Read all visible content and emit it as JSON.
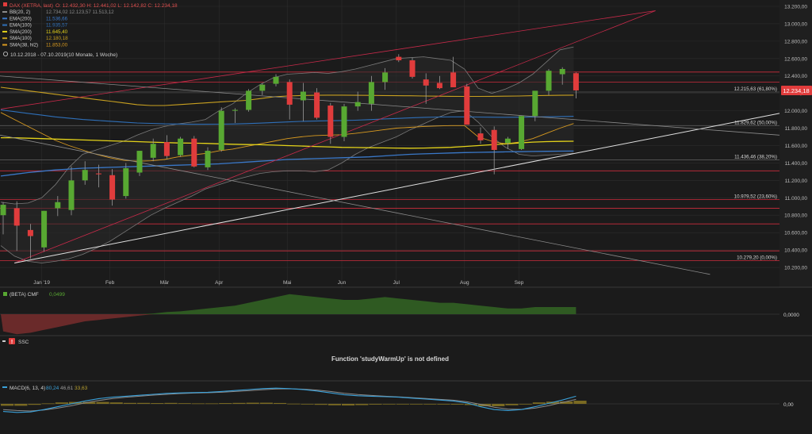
{
  "instrument": {
    "symbol": "DAX (XETRA, last)",
    "ohlc": "O: 12.432,30  H: 12.441,02  L: 12.142,82  C: 12.234,18",
    "current_price_label": "12.234,18",
    "period": "10.12.2018 - 07.10.2019",
    "period_note": "(10 Monate, 1 Woche)"
  },
  "legend": [
    {
      "label": "BB(20, 2)",
      "values": "12.734,02  12.123,57  11.513,12",
      "color": "#8a8a8a"
    },
    {
      "label": "EMA(200)",
      "values": "11.536,66",
      "color": "#3a78c8"
    },
    {
      "label": "EMA(100)",
      "values": "11.935,57",
      "color": "#2f6fb8"
    },
    {
      "label": "SMA(200)",
      "values": "11.645,40",
      "color": "#e3d21a"
    },
    {
      "label": "SMA(100)",
      "values": "12.180,18",
      "color": "#c8a020"
    },
    {
      "label": "SMA(38, hl2)",
      "values": "11.853,00",
      "color": "#d89a20"
    }
  ],
  "indicators": {
    "cmf": {
      "label": "(BETA) CMF",
      "value": "0,0499",
      "zero_label": "0,0000"
    },
    "ssc": {
      "label": "SSC",
      "error": "Function 'studyWarmUp' is not defined"
    },
    "macd": {
      "label": "MACD(6, 13, 4)",
      "v1": "80,24",
      "v2": "46,61",
      "v3": "33,63",
      "zero_label": "0,00"
    }
  },
  "colors": {
    "up": "#58a832",
    "down": "#e03c3c",
    "fib": "#cc2c3c",
    "grid": "#2c2c2c",
    "background": "#1b1b1b"
  },
  "chart_data": {
    "type": "candlestick",
    "ylim": [
      10100,
      13200
    ],
    "y_ticks": [
      "13.200,00",
      "13.000,00",
      "12.800,00",
      "12.600,00",
      "12.400,00",
      "12.200,00",
      "12.000,00",
      "11.800,00",
      "11.600,00",
      "11.400,00",
      "11.200,00",
      "11.000,00",
      "10.800,00",
      "10.600,00",
      "10.400,00",
      "10.200,00"
    ],
    "x_labels": [
      {
        "label": "Jan '19",
        "week": 3
      },
      {
        "label": "Feb",
        "week": 8
      },
      {
        "label": "Mär",
        "week": 12
      },
      {
        "label": "Apr",
        "week": 16
      },
      {
        "label": "Mai",
        "week": 21
      },
      {
        "label": "Jun",
        "week": 25
      },
      {
        "label": "Jul",
        "week": 29
      },
      {
        "label": "Aug",
        "week": 34
      },
      {
        "label": "Sep",
        "week": 38
      }
    ],
    "candles": [
      {
        "o": 10800,
        "h": 10950,
        "l": 10580,
        "c": 10920
      },
      {
        "o": 10880,
        "h": 10960,
        "l": 10390,
        "c": 10680
      },
      {
        "o": 10630,
        "h": 10700,
        "l": 10300,
        "c": 10560
      },
      {
        "o": 10430,
        "h": 10850,
        "l": 10380,
        "c": 10850
      },
      {
        "o": 10880,
        "h": 11020,
        "l": 10790,
        "c": 10950
      },
      {
        "o": 10860,
        "h": 11360,
        "l": 10800,
        "c": 11200
      },
      {
        "o": 11200,
        "h": 11420,
        "l": 11150,
        "c": 11320
      },
      {
        "o": 11280,
        "h": 11380,
        "l": 11120,
        "c": 11270
      },
      {
        "o": 11260,
        "h": 11330,
        "l": 10910,
        "c": 10980
      },
      {
        "o": 11020,
        "h": 11400,
        "l": 10990,
        "c": 11340
      },
      {
        "o": 11290,
        "h": 11540,
        "l": 11250,
        "c": 11540
      },
      {
        "o": 11460,
        "h": 11680,
        "l": 11420,
        "c": 11620
      },
      {
        "o": 11640,
        "h": 11720,
        "l": 11450,
        "c": 11480
      },
      {
        "o": 11490,
        "h": 11700,
        "l": 11470,
        "c": 11680
      },
      {
        "o": 11680,
        "h": 11710,
        "l": 11350,
        "c": 11360
      },
      {
        "o": 11350,
        "h": 11580,
        "l": 11320,
        "c": 11540
      },
      {
        "o": 11550,
        "h": 12040,
        "l": 11530,
        "c": 12000
      },
      {
        "o": 12000,
        "h": 12030,
        "l": 11860,
        "c": 12010
      },
      {
        "o": 12010,
        "h": 12250,
        "l": 11990,
        "c": 12230
      },
      {
        "o": 12230,
        "h": 12320,
        "l": 12180,
        "c": 12300
      },
      {
        "o": 12310,
        "h": 12420,
        "l": 12280,
        "c": 12390
      },
      {
        "o": 12330,
        "h": 12360,
        "l": 11900,
        "c": 12070
      },
      {
        "o": 12120,
        "h": 12320,
        "l": 11880,
        "c": 12220
      },
      {
        "o": 12210,
        "h": 12260,
        "l": 11900,
        "c": 11920
      },
      {
        "o": 12060,
        "h": 12090,
        "l": 11620,
        "c": 11700
      },
      {
        "o": 11700,
        "h": 12080,
        "l": 11650,
        "c": 12050
      },
      {
        "o": 12050,
        "h": 12220,
        "l": 12000,
        "c": 12100
      },
      {
        "o": 12080,
        "h": 12400,
        "l": 12000,
        "c": 12330
      },
      {
        "o": 12330,
        "h": 12490,
        "l": 12240,
        "c": 12440
      },
      {
        "o": 12620,
        "h": 12650,
        "l": 12560,
        "c": 12580
      },
      {
        "o": 12580,
        "h": 12610,
        "l": 12370,
        "c": 12390
      },
      {
        "o": 12360,
        "h": 12430,
        "l": 12080,
        "c": 12290
      },
      {
        "o": 12320,
        "h": 12400,
        "l": 12250,
        "c": 12260
      },
      {
        "o": 12440,
        "h": 12620,
        "l": 12270,
        "c": 12270
      },
      {
        "o": 12280,
        "h": 12310,
        "l": 11860,
        "c": 11840
      },
      {
        "o": 11740,
        "h": 11810,
        "l": 11620,
        "c": 11660
      },
      {
        "o": 11780,
        "h": 11820,
        "l": 11270,
        "c": 11550
      },
      {
        "o": 11630,
        "h": 11700,
        "l": 11560,
        "c": 11680
      },
      {
        "o": 11560,
        "h": 11940,
        "l": 11550,
        "c": 11940
      },
      {
        "o": 11940,
        "h": 12210,
        "l": 11880,
        "c": 12230
      },
      {
        "o": 12230,
        "h": 12480,
        "l": 12180,
        "c": 12460
      },
      {
        "o": 12420,
        "h": 12500,
        "l": 12300,
        "c": 12480
      },
      {
        "o": 12432,
        "h": 12441,
        "l": 12142,
        "c": 12234
      }
    ],
    "fib_levels": [
      {
        "value": 12445,
        "label": ""
      },
      {
        "value": 12328,
        "label": ""
      },
      {
        "value": 12215.63,
        "label": "12.215,63 (61,80%)"
      },
      {
        "value": 11829.62,
        "label": "11.829,62 (50,00%)"
      },
      {
        "value": 11436.46,
        "label": "11.436,46 (38,20%)"
      },
      {
        "value": 11310,
        "label": ""
      },
      {
        "value": 10979.52,
        "label": "10.979,52 (23,60%)"
      },
      {
        "value": 10880,
        "label": ""
      },
      {
        "value": 10700,
        "label": ""
      },
      {
        "value": 10390,
        "label": ""
      },
      {
        "value": 10279.2,
        "label": "10.279,20 (0,00%)"
      }
    ],
    "series": {
      "sma200": [
        11690,
        11690,
        11685,
        11680,
        11675,
        11670,
        11665,
        11660,
        11655,
        11650,
        11645,
        11640,
        11635,
        11630,
        11628,
        11625,
        11620,
        11615,
        11612,
        11610,
        11605,
        11600,
        11595,
        11590,
        11585,
        11580,
        11578,
        11575,
        11573,
        11572,
        11570,
        11572,
        11575,
        11580,
        11590,
        11600,
        11610,
        11620,
        11630,
        11640,
        11645,
        11648,
        11650
      ],
      "ema200": [
        11250,
        11270,
        11290,
        11305,
        11320,
        11330,
        11340,
        11345,
        11350,
        11355,
        11360,
        11365,
        11370,
        11375,
        11380,
        11385,
        11390,
        11400,
        11410,
        11420,
        11430,
        11440,
        11445,
        11450,
        11455,
        11460,
        11465,
        11470,
        11480,
        11490,
        11500,
        11505,
        11510,
        11515,
        11520,
        11522,
        11525,
        11528,
        11530,
        11532,
        11534,
        11536,
        11537
      ],
      "ema100": [
        12010,
        11990,
        11970,
        11950,
        11930,
        11915,
        11900,
        11890,
        11880,
        11870,
        11860,
        11855,
        11850,
        11848,
        11845,
        11845,
        11846,
        11848,
        11852,
        11858,
        11865,
        11872,
        11878,
        11882,
        11885,
        11888,
        11892,
        11898,
        11905,
        11912,
        11918,
        11924,
        11928,
        11930,
        11930,
        11928,
        11926,
        11925,
        11926,
        11928,
        11931,
        11934,
        11936
      ],
      "sma100": [
        12270,
        12250,
        12230,
        12210,
        12190,
        12170,
        12150,
        12130,
        12110,
        12090,
        12070,
        12060,
        12060,
        12070,
        12080,
        12090,
        12100,
        12110,
        12120,
        12140,
        12160,
        12170,
        12175,
        12178,
        12180,
        12180,
        12178,
        12177,
        12175,
        12173,
        12172,
        12170,
        12168,
        12166,
        12165,
        12165,
        12166,
        12168,
        12170,
        12173,
        12176,
        12178,
        12180
      ],
      "sma38": [
        11980,
        11900,
        11820,
        11740,
        11660,
        11600,
        11550,
        11500,
        11460,
        11430,
        11420,
        11425,
        11440,
        11470,
        11490,
        11510,
        11540,
        11560,
        11590,
        11620,
        11650,
        11680,
        11700,
        11715,
        11720,
        11725,
        11740,
        11760,
        11780,
        11800,
        11810,
        11820,
        11825,
        11830,
        11830,
        11700,
        11650,
        11620,
        11640,
        11680,
        11740,
        11800,
        11853
      ],
      "bb_upper": [
        10950,
        10930,
        10940,
        11000,
        11150,
        11350,
        11500,
        11550,
        11600,
        11650,
        11720,
        11780,
        11820,
        11850,
        11870,
        11900,
        12000,
        12080,
        12200,
        12300,
        12380,
        12420,
        12430,
        12440,
        12430,
        12450,
        12480,
        12520,
        12560,
        12600,
        12610,
        12620,
        12600,
        12580,
        12480,
        12260,
        12200,
        12250,
        12320,
        12420,
        12560,
        12700,
        12734
      ],
      "bb_lower": [
        10450,
        10330,
        10270,
        10250,
        10270,
        10300,
        10350,
        10420,
        10500,
        10600,
        10700,
        10800,
        10880,
        10950,
        11020,
        11100,
        11150,
        11200,
        11240,
        11280,
        11300,
        11310,
        11310,
        11300,
        11320,
        11400,
        11500,
        11580,
        11640,
        11700,
        11780,
        11850,
        11920,
        11980,
        12000,
        11870,
        11700,
        11580,
        11500,
        11480,
        11490,
        11500,
        11513
      ],
      "cmf": [
        -0.12,
        -0.14,
        -0.13,
        -0.11,
        -0.09,
        -0.07,
        -0.05,
        -0.04,
        -0.03,
        -0.02,
        -0.01,
        0.005,
        0.015,
        0.02,
        0.03,
        0.04,
        0.05,
        0.06,
        0.08,
        0.1,
        0.12,
        0.14,
        0.13,
        0.12,
        0.11,
        0.1,
        0.1,
        0.11,
        0.12,
        0.11,
        0.1,
        0.09,
        0.08,
        0.08,
        0.07,
        0.06,
        0.05,
        0.04,
        0.04,
        0.05,
        0.05,
        0.05,
        0.05
      ],
      "macd_line": [
        -80,
        -90,
        -85,
        -60,
        -30,
        0,
        30,
        55,
        70,
        80,
        90,
        100,
        110,
        115,
        118,
        122,
        130,
        140,
        150,
        160,
        165,
        160,
        150,
        135,
        115,
        95,
        85,
        80,
        75,
        70,
        60,
        50,
        40,
        30,
        10,
        -30,
        -60,
        -70,
        -60,
        -30,
        5,
        40,
        80
      ],
      "macd_signal": [
        -60,
        -70,
        -75,
        -65,
        -45,
        -20,
        10,
        35,
        55,
        70,
        80,
        92,
        100,
        108,
        113,
        117,
        122,
        130,
        138,
        148,
        156,
        158,
        154,
        145,
        130,
        112,
        98,
        88,
        80,
        73,
        65,
        56,
        47,
        38,
        22,
        -5,
        -35,
        -55,
        -58,
        -45,
        -18,
        15,
        47
      ],
      "macd_hist": [
        -20,
        -20,
        -10,
        5,
        15,
        20,
        20,
        20,
        15,
        10,
        10,
        8,
        10,
        7,
        5,
        5,
        8,
        10,
        12,
        12,
        9,
        2,
        -4,
        -10,
        -15,
        -17,
        -13,
        -8,
        -5,
        -3,
        -5,
        -6,
        -7,
        -8,
        -12,
        -25,
        -25,
        -15,
        -2,
        15,
        23,
        25,
        33
      ]
    }
  }
}
